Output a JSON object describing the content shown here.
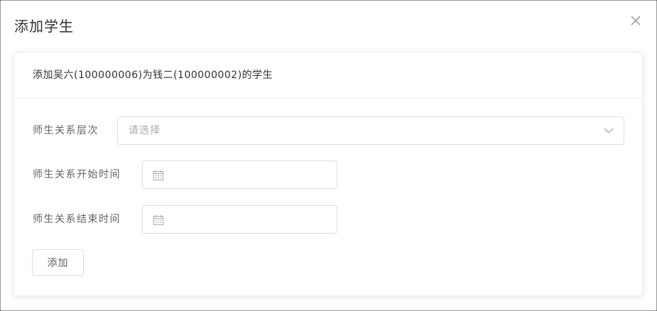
{
  "dialog": {
    "title": "添加学生",
    "close_icon": "close-icon"
  },
  "card": {
    "header_text": "添加吴六(100000006)为钱二(100000002)的学生"
  },
  "form": {
    "level": {
      "label": "师生关系层次",
      "placeholder": "请选择",
      "arrow_icon": "chevron-down-icon"
    },
    "start_time": {
      "label": "师生关系开始时间",
      "value": "",
      "icon": "calendar-icon"
    },
    "end_time": {
      "label": "师生关系结束时间",
      "value": "",
      "icon": "calendar-icon"
    },
    "submit_label": "添加"
  },
  "colors": {
    "border": "#dcdfe6",
    "placeholder": "#a8abb2",
    "label": "#606266",
    "title": "#303133"
  }
}
